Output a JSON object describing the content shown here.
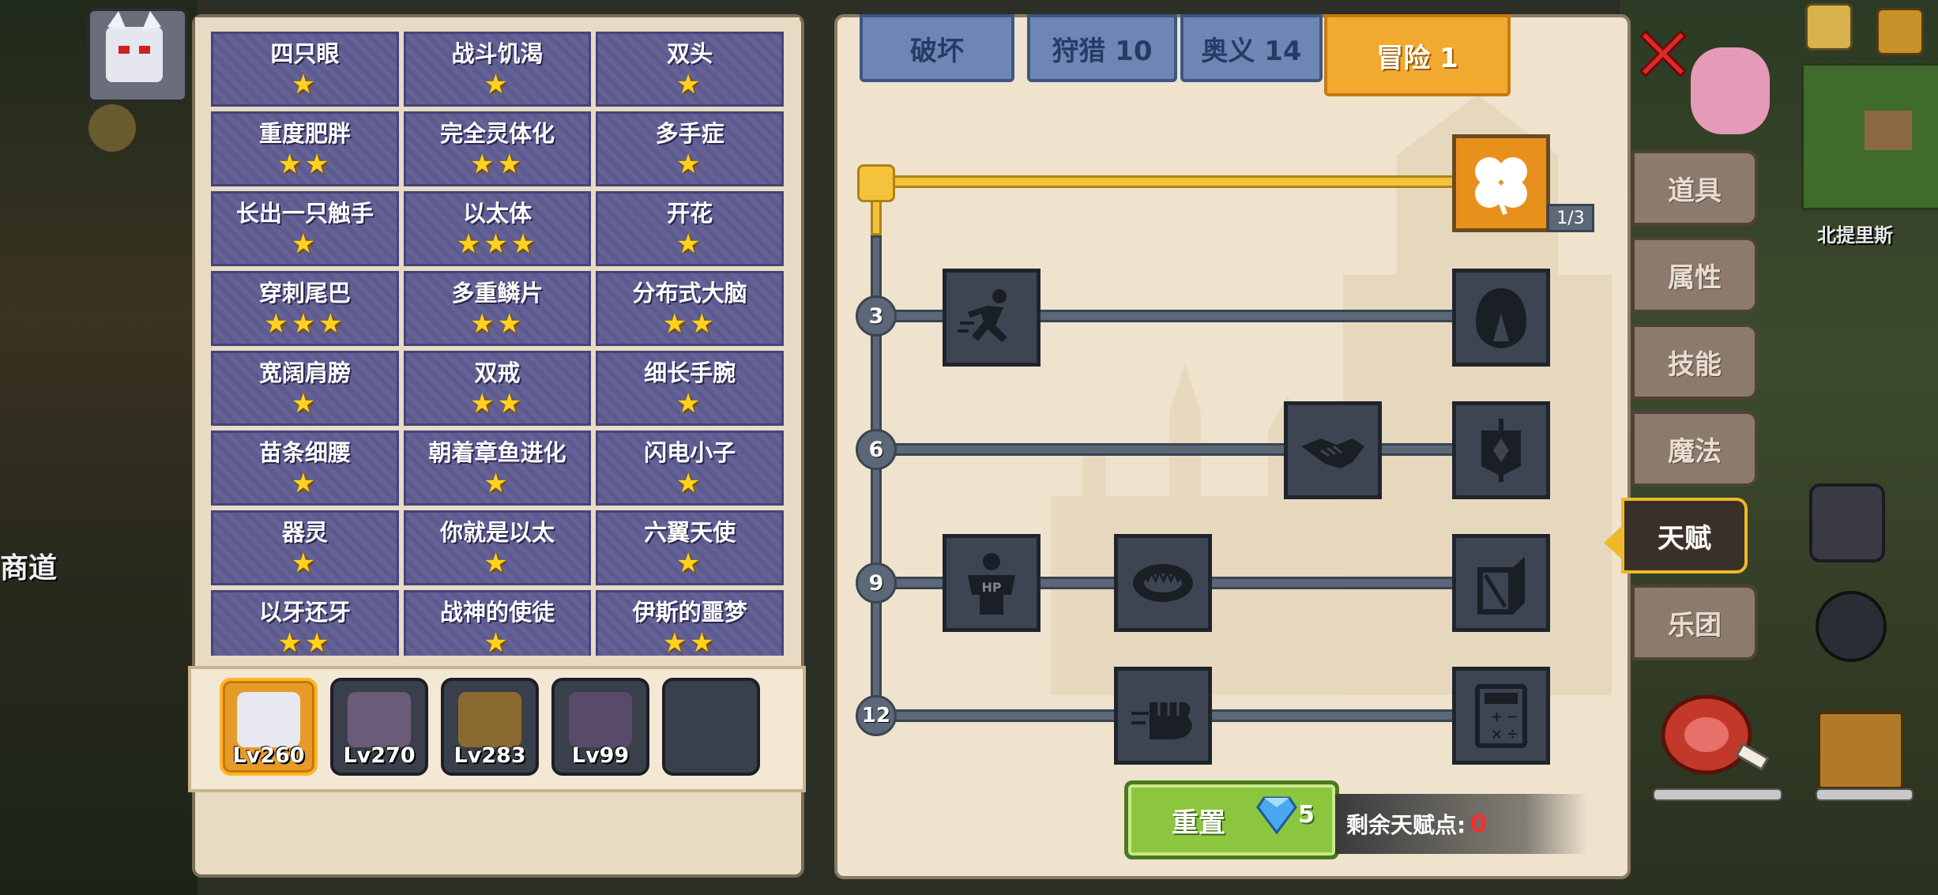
{
  "map": {
    "location_name": "北提里斯",
    "side_text": "商道"
  },
  "traits": [
    {
      "name": "四只眼",
      "stars": 1
    },
    {
      "name": "战斗饥渴",
      "stars": 1
    },
    {
      "name": "双头",
      "stars": 1
    },
    {
      "name": "重度肥胖",
      "stars": 2
    },
    {
      "name": "完全灵体化",
      "stars": 2
    },
    {
      "name": "多手症",
      "stars": 1
    },
    {
      "name": "长出一只触手",
      "stars": 1
    },
    {
      "name": "以太体",
      "stars": 3
    },
    {
      "name": "开花",
      "stars": 1
    },
    {
      "name": "穿刺尾巴",
      "stars": 3
    },
    {
      "name": "多重鳞片",
      "stars": 2
    },
    {
      "name": "分布式大脑",
      "stars": 2
    },
    {
      "name": "宽阔肩膀",
      "stars": 1
    },
    {
      "name": "双戒",
      "stars": 2
    },
    {
      "name": "细长手腕",
      "stars": 1
    },
    {
      "name": "苗条细腰",
      "stars": 1
    },
    {
      "name": "朝着章鱼进化",
      "stars": 1
    },
    {
      "name": "闪电小子",
      "stars": 1
    },
    {
      "name": "器灵",
      "stars": 1
    },
    {
      "name": "你就是以太",
      "stars": 1
    },
    {
      "name": "六翼天使",
      "stars": 1
    },
    {
      "name": "以牙还牙",
      "stars": 2
    },
    {
      "name": "战神的使徒",
      "stars": 1
    },
    {
      "name": "伊斯的噩梦",
      "stars": 2
    }
  ],
  "heroes": [
    {
      "level": "Lv260",
      "selected": true,
      "color": "#e8e8f0"
    },
    {
      "level": "Lv270",
      "selected": false,
      "color": "#6b5a78"
    },
    {
      "level": "Lv283",
      "selected": false,
      "color": "#8a6a30"
    },
    {
      "level": "Lv99",
      "selected": false,
      "color": "#5a4a6a"
    },
    {
      "level": "",
      "selected": false,
      "color": "#3a3f4c"
    }
  ],
  "tabs": [
    {
      "label": "破坏"
    },
    {
      "label": "狩猎 10"
    },
    {
      "label": "奥义 14"
    },
    {
      "label": "冒险 1"
    }
  ],
  "tree": {
    "tier_labels": [
      "3",
      "6",
      "9",
      "12"
    ],
    "top_talent_count": "1/3"
  },
  "reset": {
    "label": "重置",
    "cost": "5"
  },
  "remaining": {
    "label": "剩余天赋点:",
    "value": "0"
  },
  "side_tabs": [
    {
      "label": "道具"
    },
    {
      "label": "属性"
    },
    {
      "label": "技能"
    },
    {
      "label": "魔法"
    },
    {
      "label": "天赋"
    },
    {
      "label": "乐团"
    }
  ],
  "colors": {
    "accent_gold": "#f2a930",
    "trait_purple": "#5d5a8f",
    "tab_blue": "#6d86b4",
    "reset_green": "#8cc63e"
  }
}
